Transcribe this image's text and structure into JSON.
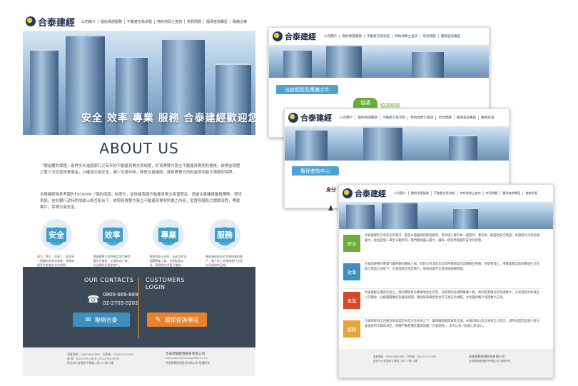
{
  "brand": {
    "name": "合泰建經"
  },
  "nav": [
    "公司簡介",
    "履約保證服務",
    "不動產交易流程",
    "特約地政士查詢",
    "常見問題",
    "履保查詢專區",
    "聯絡合泰"
  ],
  "main": {
    "tagline": "安全 效率 專業 服務 合泰建經歡迎您",
    "about_title": "ABOUT US",
    "para1": "『價金履約保證』是許多先進國家行之有年的不動產買賣交易制度，於買賣雙方簽立不動產買賣契約書後，由價金保證之第三方控管買賣價金，以確保交易安全，減少交易糾紛，降低交易風險，讓買賣雙方的利益得到最大限度的保障。",
    "para2": "合泰建經除參考國外ESCROW『價約保證』制度外，並依據我國不動產買賣交易習慣及，透過合泰建經優質團隊，資訊系統，信託銀行及特約地政士相互配合下，依照買賣雙方簽立不動產買賣契約書之內容，監督各階段之價款流程，專款專戶，保障交易安全。",
    "features": [
      {
        "label": "安全",
        "text": "買方、賣方、同意人，要求每一個履約的安全無虞，保障每個案件都處安全的狀態。"
      },
      {
        "label": "效率",
        "text": "專業團隊立即時確定並完善相關文件資料，交易款項入帳，迅速撥款至指定帳戶。"
      },
      {
        "label": "專業",
        "text": "專業地政士合理，法務及財金相關專業人員，共同監督交易，落實價金控管及稽核。"
      },
      {
        "label": "服務",
        "text": "業務服務經由於本業所獲的客戶，客戶至上的精神進行全程交易服務的品質。"
      }
    ],
    "contact": {
      "title": "OUR CONTACTS",
      "phone1": "0800-669-689",
      "phone2": "02-2703-0202",
      "login_title": "CUSTOMERS LOGIN",
      "btn_contact": "聯絡合泰",
      "btn_query": "履保查詢專區"
    },
    "footer": {
      "line1": "客服專線：0800-669-689　代表號：(02)2703-0202",
      "line2": "傳 真：(02)2755-2626 / (02)2784-9533",
      "line3": "臺北市大安區和平東路二段177號11樓",
      "company": "合泰建築經理股份有限公司",
      "company_en": "HAN-TAI REAL ESTATE MANAGEMENT CO.,LTD.",
      "copyright": "合泰建築經理股份有限公司 版權所有"
    }
  },
  "card1": {
    "section": "出款類型及應備文件",
    "tab1": "協議",
    "tab2": "協議取款"
  },
  "card2": {
    "section": "履保查詢中心",
    "label": "身分"
  },
  "card3": {
    "rows": [
      {
        "label": "安全",
        "color": "#6cab3c",
        "text": "合泰建經對交易安全的要求，都是以最嚴謹的態度處理，用同理心看待每一個案件，要求每一個履約安全無虞，每個案件交易金額龐大，往往是個人畢生辛勤所得，我們都要盡心盡力，讓每一個案件都處於安全的狀態。"
      },
      {
        "label": "效率",
        "color": "#3d8fbf",
        "text": "合泰建經擁有豐富代書經驗的審核人員，對對交易流程及出款時機都是非常瞭解且熟練，時間管理上，準確掌握出款時機並在交易安全無虞之前提下，迅速撥款至指定帳戶，使每個案件交易過程順暢無礙。"
      },
      {
        "label": "專業",
        "color": "#d9482b",
        "text": "合泰建經在價金控管上，特別聘請具有專業地政士背景，法務及財金相關專業人員，共同監督價金的保證帳戶，交易過程中每筆出入的價金，必經層層審核及稽核把關，確保每筆價金皆合乎交易安全規範，才從價金帳戶保證專戶支用。"
      },
      {
        "label": "服務",
        "color": "#e8a33a",
        "text": "合泰建經與全台數百家加盟店多年合作往來之下，業務服務範圍遍及全國，本著同理心及交易安全之理念，適時加盟店及客戶對合泰建經的信賴與肯定，實踐不動產價金履保保護『合泰建經』，您可以多一點安心及放心。"
      }
    ],
    "footer_line1": "客服專線：0800-669-689　代表號：(02)2703-0202",
    "footer_line2": "臺北市大安區和平東路二段177號11樓",
    "company": "合泰建築經理股份有限公司",
    "copyright": "合泰建築經理股份有限公司 版權所有"
  }
}
